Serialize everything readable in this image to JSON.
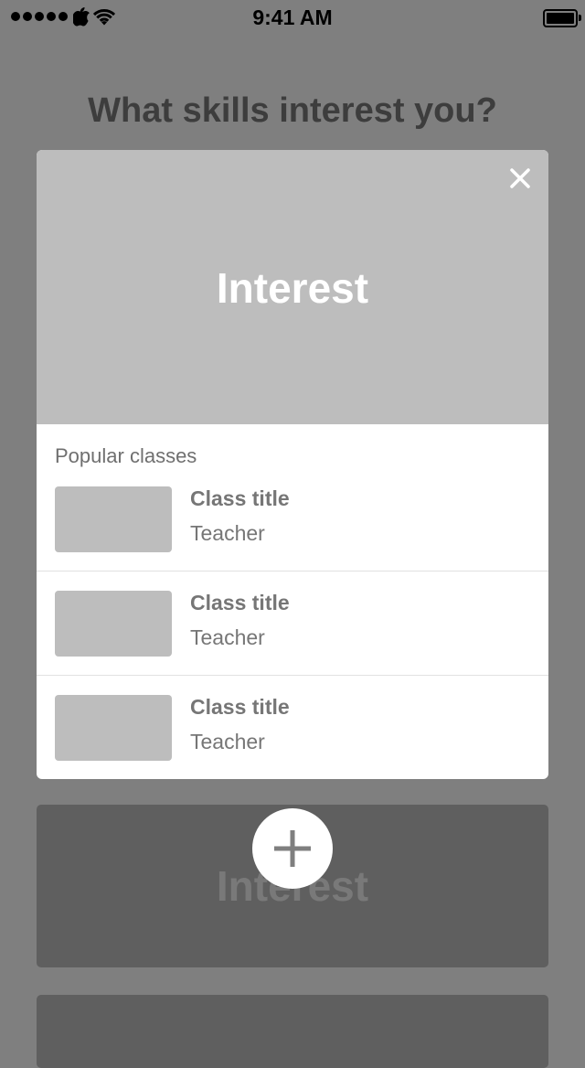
{
  "status_bar": {
    "time": "9:41 AM",
    "icons": [
      "signal-dots-icon",
      "apple-icon",
      "wifi-icon",
      "battery-icon"
    ]
  },
  "page": {
    "title": "What skills interest you?"
  },
  "modal": {
    "hero_title": "Interest",
    "close_icon": "close-icon",
    "section_title": "Popular classes",
    "classes": [
      {
        "title": "Class title",
        "teacher": "Teacher"
      },
      {
        "title": "Class title",
        "teacher": "Teacher"
      },
      {
        "title": "Class title",
        "teacher": "Teacher"
      }
    ]
  },
  "background_cards": [
    {
      "label": "Interest"
    },
    {
      "label": ""
    }
  ],
  "add_button": {
    "icon": "plus-icon"
  },
  "colors": {
    "backdrop": "#7f7f7f",
    "hero": "#bdbdbd",
    "card": "#5f5f5f",
    "text_gray": "#767676"
  }
}
